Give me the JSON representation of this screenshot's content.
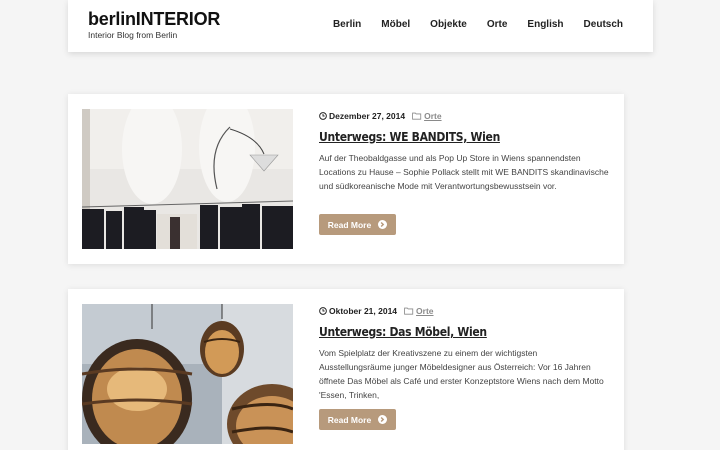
{
  "site": {
    "title": "berlinINTERIOR",
    "tagline": "Interior Blog from Berlin"
  },
  "nav": [
    "Berlin",
    "Möbel",
    "Objekte",
    "Orte",
    "English",
    "Deutsch"
  ],
  "posts": [
    {
      "date": "Dezember 27, 2014",
      "category": "Orte",
      "title": "Unterwegs: WE BANDITS, Wien",
      "excerpt": "Auf der Theobaldgasse und als Pop Up Store in Wiens spannendsten Locations zu Hause – Sophie Pollack stellt mit WE BANDITS skandinavische und südkoreanische Mode mit Verantwortungsbewusstsein vor.",
      "button": "Read More"
    },
    {
      "date": "Oktober 21, 2014",
      "category": "Orte",
      "title": "Unterwegs: Das Möbel, Wien",
      "excerpt": "Vom Spielplatz der Kreativszene zu einem der wichtigsten Ausstellungsräume junger Möbeldesigner aus Österreich: Vor 16 Jahren öffnete Das Möbel als Café und erster Konzeptstore Wiens nach dem Motto 'Essen, Trinken,",
      "button": "Read More"
    }
  ]
}
